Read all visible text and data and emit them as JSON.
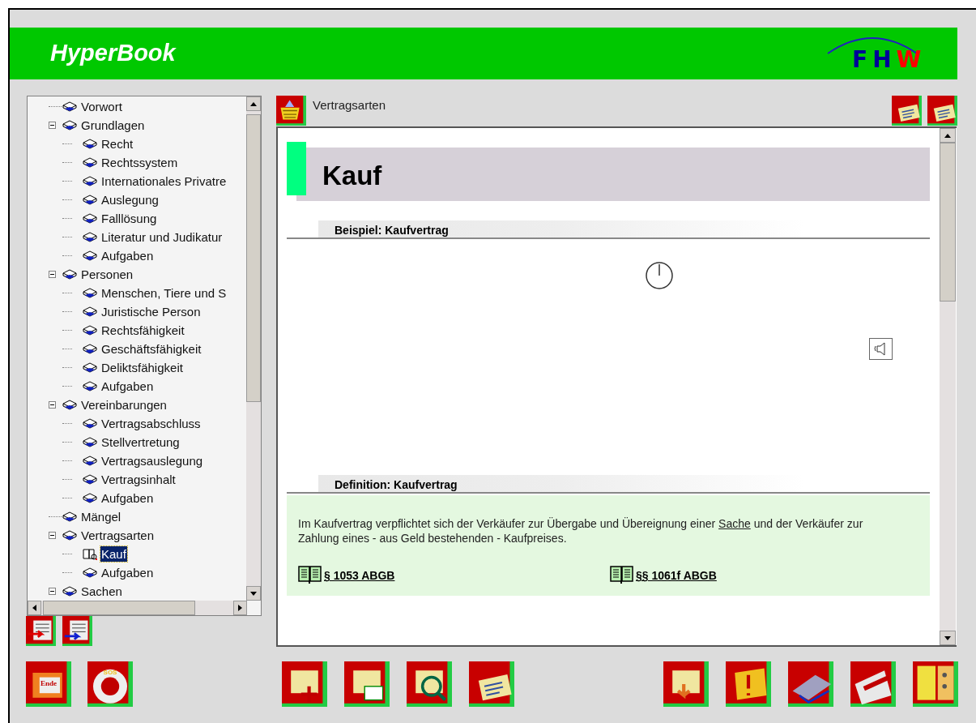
{
  "app": {
    "title": "HyperBook",
    "logo": [
      {
        "text": "FH",
        "color": "#000099"
      },
      {
        "text": "W",
        "color": "#ff0000"
      }
    ]
  },
  "tree": [
    {
      "label": "Vorwort",
      "selected": false
    },
    {
      "label": "Grundlagen",
      "selected": false,
      "expanded": true,
      "children": [
        {
          "label": "Recht",
          "selected": false
        },
        {
          "label": "Rechtssystem",
          "selected": false
        },
        {
          "label": "Internationales Privatre",
          "selected": false
        },
        {
          "label": "Auslegung",
          "selected": false
        },
        {
          "label": "Falllösung",
          "selected": false
        },
        {
          "label": "Literatur und Judikatur",
          "selected": false
        },
        {
          "label": "Aufgaben",
          "selected": false
        }
      ]
    },
    {
      "label": "Personen",
      "selected": false,
      "expanded": true,
      "children": [
        {
          "label": "Menschen, Tiere und S",
          "selected": false
        },
        {
          "label": "Juristische Person",
          "selected": false
        },
        {
          "label": "Rechtsfähigkeit",
          "selected": false
        },
        {
          "label": "Geschäftsfähigkeit",
          "selected": false
        },
        {
          "label": "Deliktsfähigkeit",
          "selected": false
        },
        {
          "label": "Aufgaben",
          "selected": false
        }
      ]
    },
    {
      "label": "Vereinbarungen",
      "selected": false,
      "expanded": true,
      "children": [
        {
          "label": "Vertragsabschluss",
          "selected": false
        },
        {
          "label": "Stellvertretung",
          "selected": false
        },
        {
          "label": "Vertragsauslegung",
          "selected": false
        },
        {
          "label": "Vertragsinhalt",
          "selected": false
        },
        {
          "label": "Aufgaben",
          "selected": false
        }
      ]
    },
    {
      "label": "Mängel",
      "selected": false
    },
    {
      "label": "Vertragsarten",
      "selected": false,
      "expanded": true,
      "children": [
        {
          "label": "Kauf",
          "selected": true
        },
        {
          "label": "Aufgaben",
          "selected": false
        }
      ]
    },
    {
      "label": "Sachen",
      "selected": false,
      "expanded": true
    }
  ],
  "breadcrumb": "Vertragsarten",
  "page": {
    "title": "Kauf",
    "sections": [
      {
        "kind": "media",
        "heading": "Beispiel: Kaufvertrag"
      },
      {
        "kind": "definition",
        "heading": "Definition: Kaufvertrag",
        "text_before": "Im Kaufvertrag verpflichtet sich der Verkäufer zur Übergabe und Übereignung einer ",
        "link": "Sache",
        "text_after": " und der Verkäufer zur Zahlung eines - aus Geld bestehenden - Kaufpreises.",
        "references": [
          "§ 1053 ABGB",
          "§§ 1061f ABGB"
        ]
      }
    ]
  },
  "bottom_left_buttons": [
    {
      "label": "Ende"
    },
    {
      "label": "SOS"
    }
  ]
}
